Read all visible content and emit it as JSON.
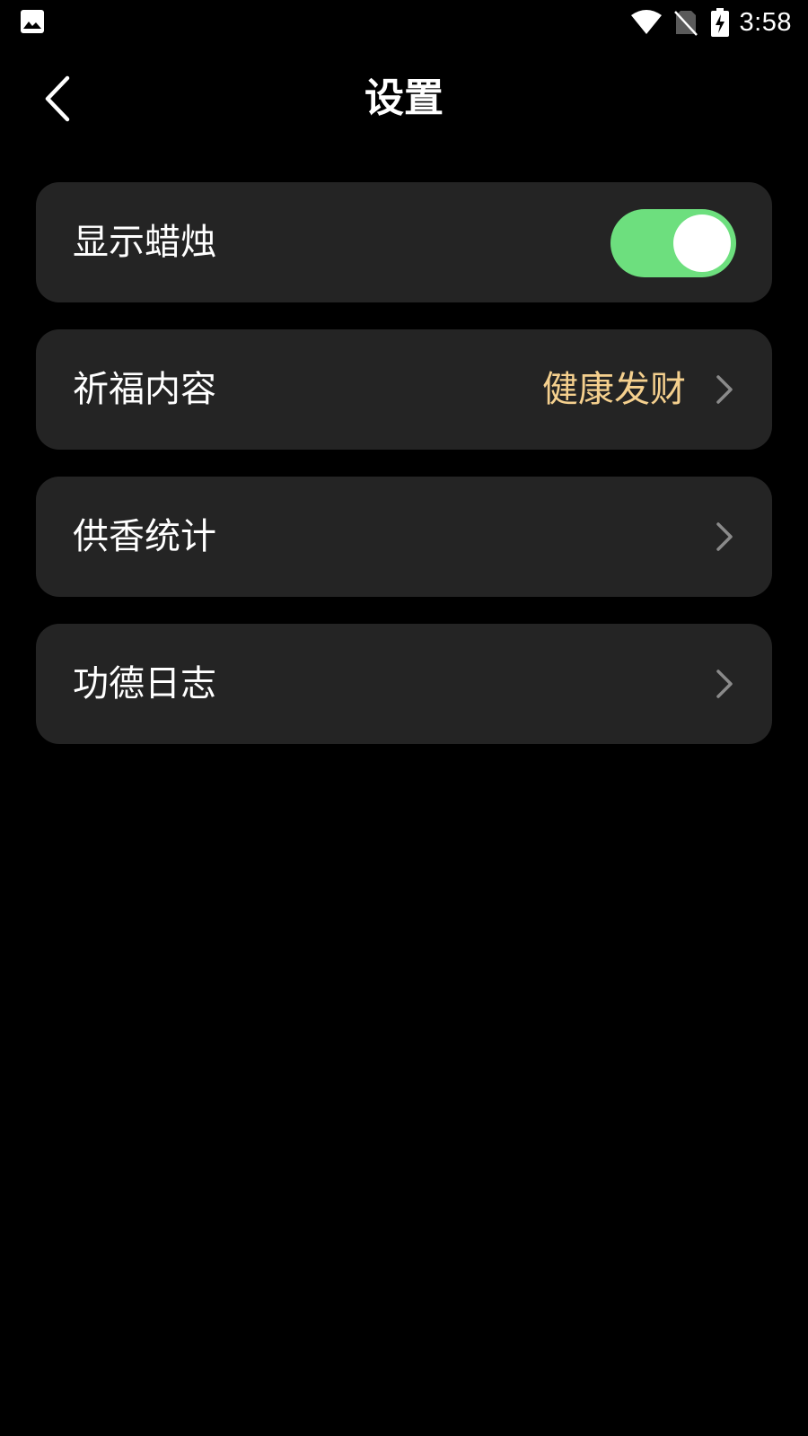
{
  "status_bar": {
    "time": "3:58",
    "icons": [
      "gallery-icon",
      "wifi-icon",
      "no-sim-icon",
      "battery-charging-icon"
    ]
  },
  "header": {
    "title": "设置",
    "back_icon": "chevron-left-icon"
  },
  "settings": {
    "show_candle": {
      "label": "显示蜡烛",
      "enabled": true
    },
    "blessing_content": {
      "label": "祈福内容",
      "value": "健康发财"
    },
    "incense_stats": {
      "label": "供香统计"
    },
    "merit_log": {
      "label": "功德日志"
    }
  },
  "colors": {
    "background": "#000000",
    "card": "#242424",
    "toggle_on": "#6ddf7e",
    "value_text": "#f5d08e",
    "chevron": "#8a8a8a"
  }
}
